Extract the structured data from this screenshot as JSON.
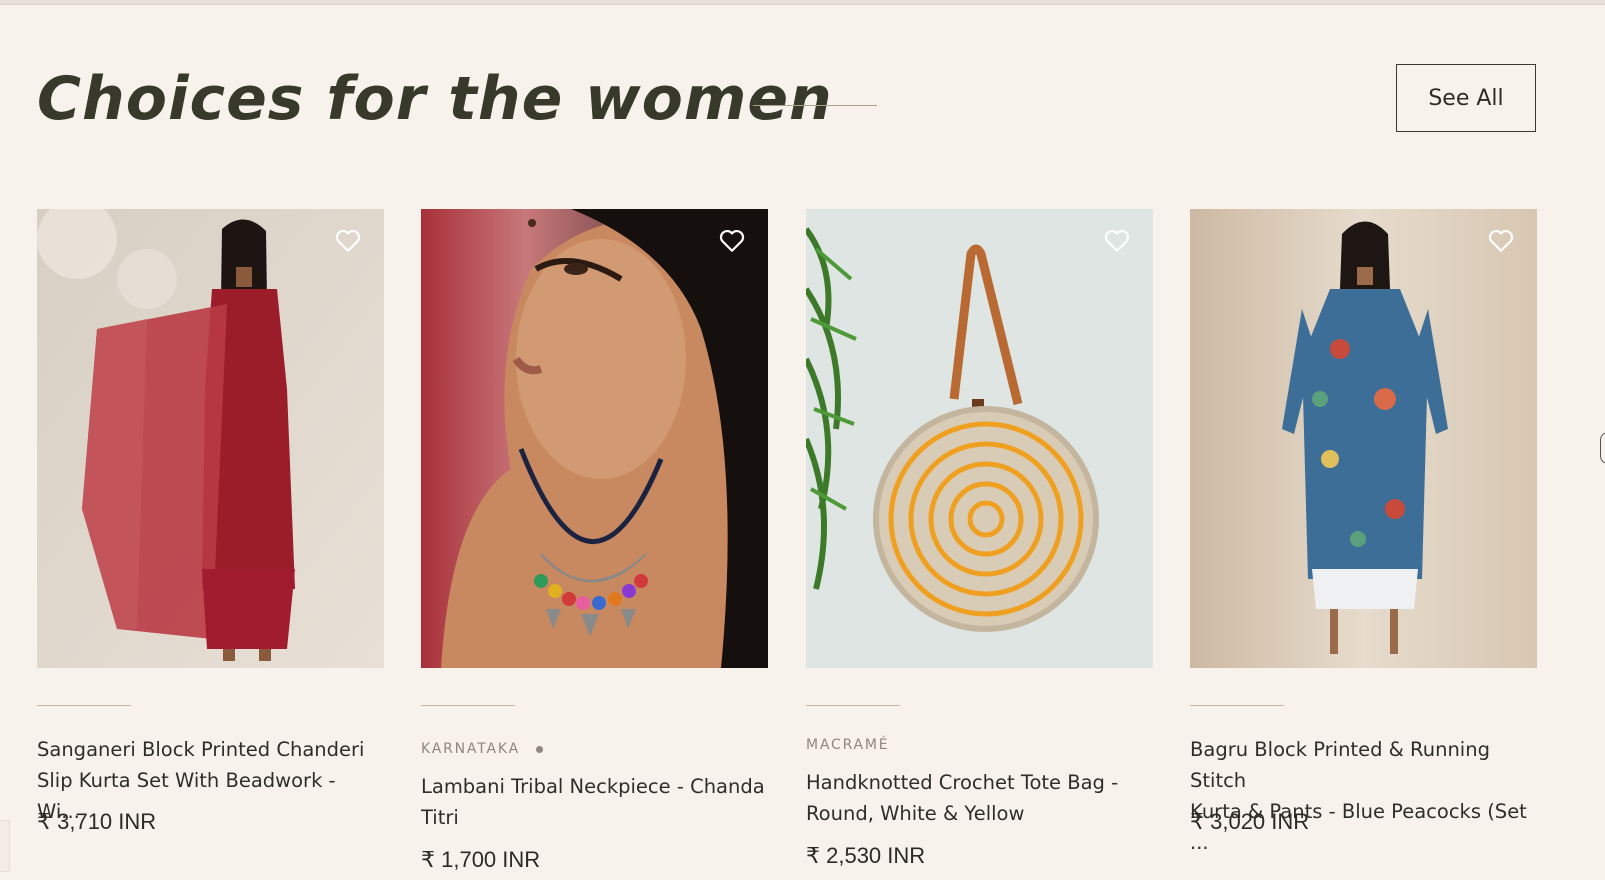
{
  "section": {
    "title": "Choices for the women",
    "see_all": "See All"
  },
  "products": [
    {
      "vendor": "",
      "name_line1": "Sanganeri Block Printed Chanderi",
      "name_line2": "Slip Kurta Set With Beadwork - Wi...",
      "price": "₹ 3,710 INR",
      "image": "woman-red-kurta-set"
    },
    {
      "vendor": "KARNATAKA",
      "name_line1": "Lambani Tribal Neckpiece - Chanda",
      "name_line2": "Titri",
      "price": "₹ 1,700 INR",
      "image": "woman-tribal-necklace"
    },
    {
      "vendor": "MACRAMÉ",
      "name_line1": "Handknotted Crochet Tote Bag -",
      "name_line2": "Round, White & Yellow",
      "price": "₹ 2,530 INR",
      "image": "round-crochet-tote-bag"
    },
    {
      "vendor": "",
      "name_line1": "Bagru Block Printed & Running Stitch",
      "name_line2": "Kurta & Pants - Blue Peacocks (Set ...",
      "price": "₹ 3,020 INR",
      "image": "woman-blue-kurta-pants"
    }
  ],
  "icons": {
    "wishlist": "heart-outline-icon"
  },
  "colors": {
    "background": "#f8f2ec",
    "title": "#37392a",
    "text": "#2e2e28",
    "muted": "#8d877d"
  }
}
